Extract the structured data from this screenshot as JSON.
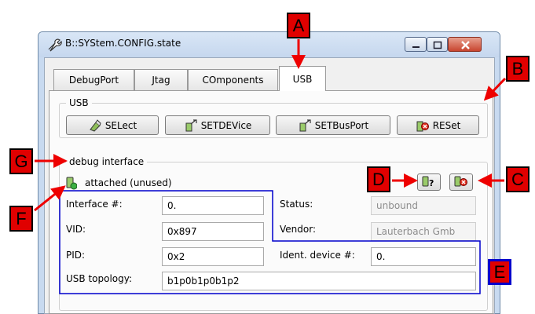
{
  "window": {
    "title": "B::SYStem.CONFIG.state"
  },
  "tabs": [
    {
      "label": "DebugPort"
    },
    {
      "label": "Jtag"
    },
    {
      "label": "COmponents"
    },
    {
      "label": "USB",
      "active": true
    }
  ],
  "usb_group": {
    "label": "USB",
    "buttons": [
      {
        "label": "SELect",
        "icon": "select-icon"
      },
      {
        "label": "SETDEVice",
        "icon": "setdevice-icon"
      },
      {
        "label": "SETBusPort",
        "icon": "setbusport-icon"
      },
      {
        "label": "RESet",
        "icon": "reset-icon"
      }
    ]
  },
  "debug_interface": {
    "label": "debug interface",
    "status_text": "attached (unused)",
    "status_icon": "attached-device-icon",
    "fields": {
      "interface_label": "Interface #:",
      "interface_value": "0.",
      "vid_label": "VID:",
      "vid_value": "0x897",
      "pid_label": "PID:",
      "pid_value": "0x2",
      "topology_label": "USB topology:",
      "topology_value": "b1p0b1p0b1p2",
      "status_label": "Status:",
      "status_value": "unbound",
      "vendor_label": "Vendor:",
      "vendor_value": "Lauterbach Gmb",
      "ident_label": "Ident. device #:",
      "ident_value": "0."
    }
  },
  "callouts": [
    "A",
    "B",
    "C",
    "D",
    "E",
    "F",
    "G"
  ],
  "colors": {
    "callout_fill": "#e00000",
    "callout_e_border": "#0000cc",
    "outline_blue": "#0000cc",
    "arrow_red": "#ee0000"
  }
}
